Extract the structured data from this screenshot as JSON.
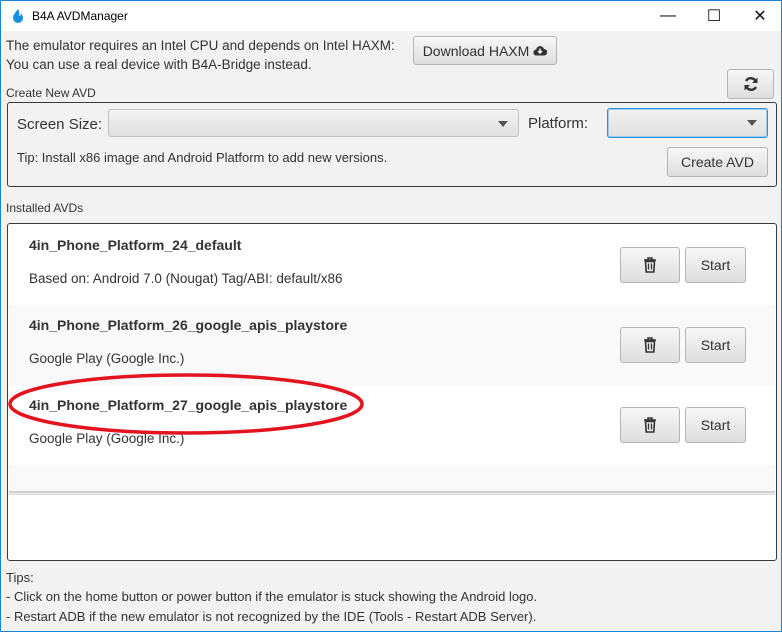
{
  "window": {
    "title": "B4A AVDManager",
    "minimize": "—",
    "maximize": "☐",
    "close": "✕"
  },
  "header": {
    "line1": "The emulator requires an Intel CPU and depends on Intel HAXM:",
    "line2": "You can use a real device with B4A-Bridge instead.",
    "download_label": "Download HAXM",
    "refresh_icon": "refresh-icon"
  },
  "create": {
    "section_label": "Create New AVD",
    "screen_size_label": "Screen Size:",
    "screen_size_value": "",
    "platform_label": "Platform:",
    "platform_value": "",
    "tip": "Tip: Install x86 image and Android Platform to add new versions.",
    "create_label": "Create AVD"
  },
  "installed": {
    "section_label": "Installed AVDs",
    "items": [
      {
        "name": "4in_Phone_Platform_24_default",
        "desc": "Based on: Android 7.0 (Nougat) Tag/ABI: default/x86",
        "start": "Start"
      },
      {
        "name": "4in_Phone_Platform_26_google_apis_playstore",
        "desc": "Google Play (Google Inc.)",
        "start": "Start"
      },
      {
        "name": "4in_Phone_Platform_27_google_apis_playstore",
        "desc": "Google Play (Google Inc.)",
        "start": "Start"
      }
    ]
  },
  "tips": {
    "title": "Tips:",
    "line1": "- Click on the home button or power button if the emulator is stuck showing the Android logo.",
    "line2": "- Restart ADB if the new emulator is not recognized by the IDE (Tools - Restart ADB Server)."
  },
  "colors": {
    "accent": "#1883d7",
    "annotation": "#e3141e"
  }
}
